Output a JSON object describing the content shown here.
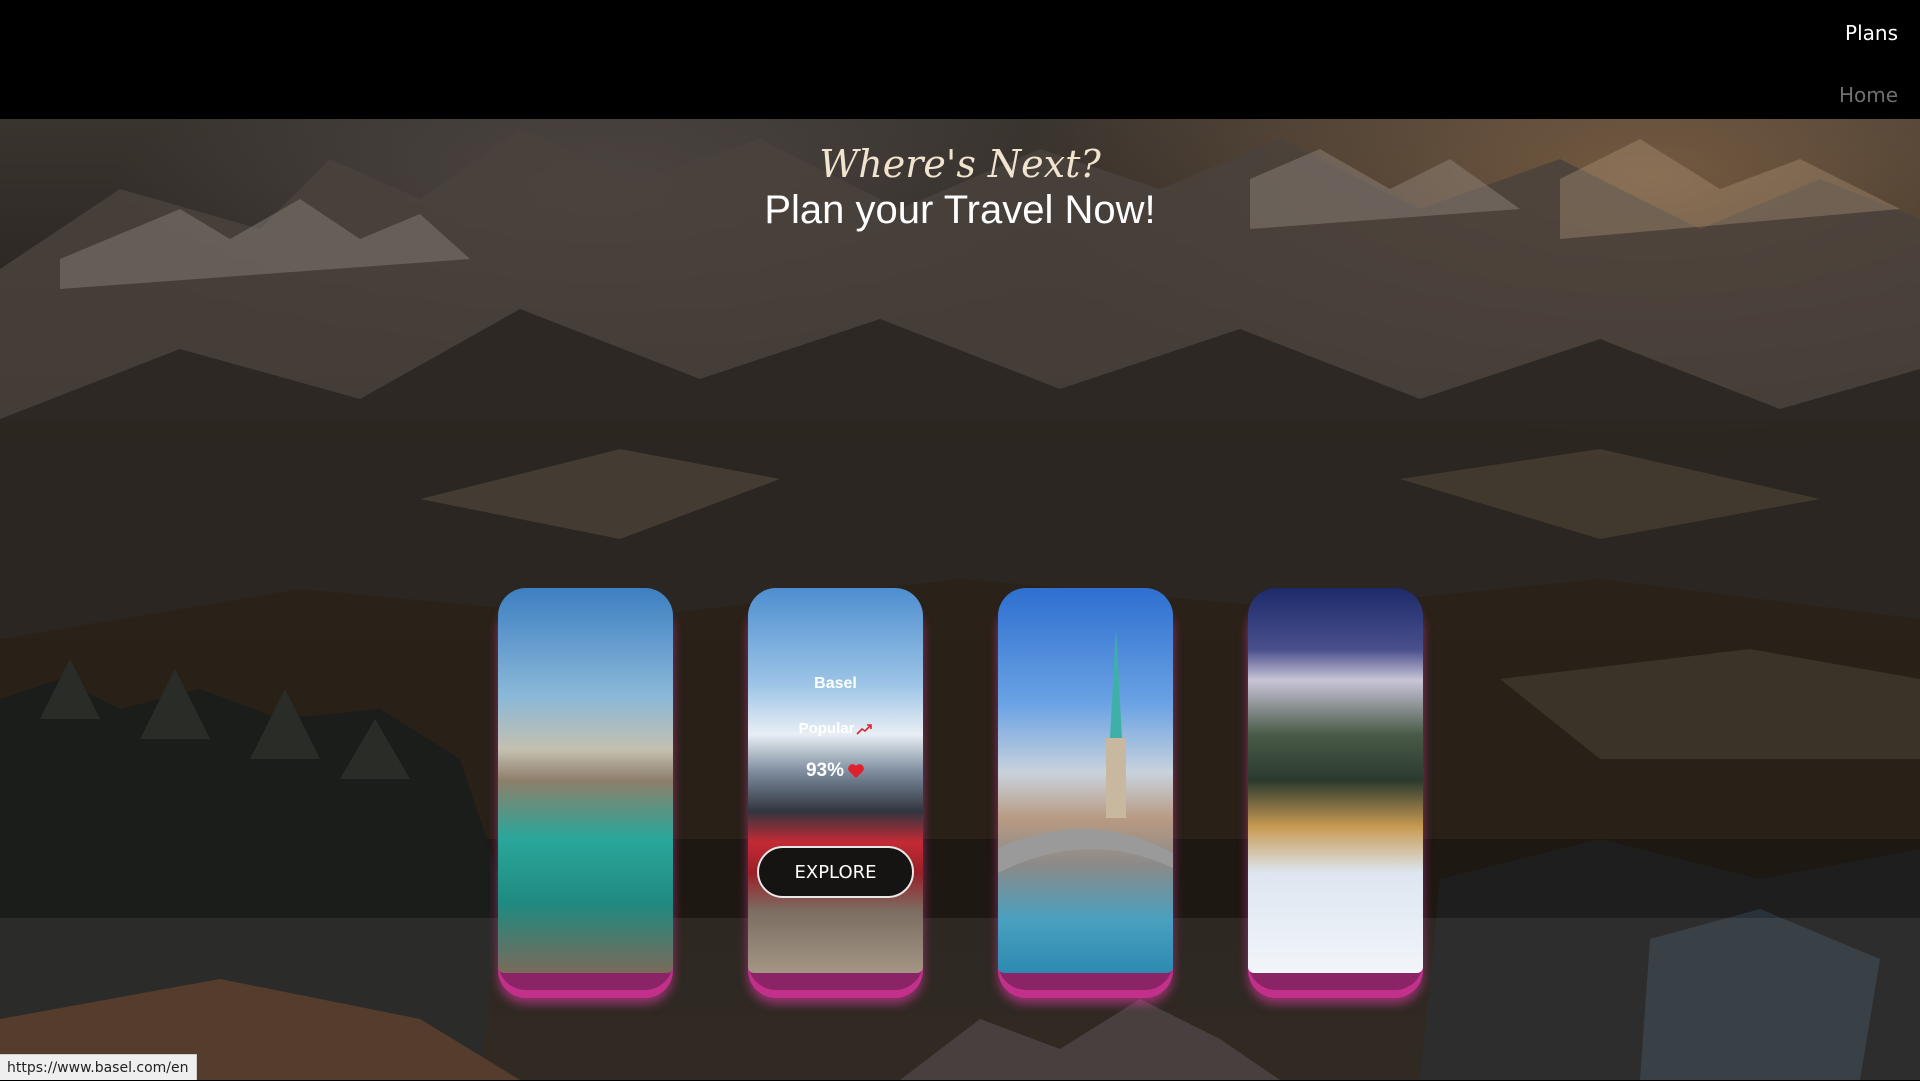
{
  "nav": {
    "plans": "Plans",
    "home": "Home"
  },
  "hero": {
    "subtitle": "Where's Next?",
    "title": "Plan your Travel Now!"
  },
  "cards": [
    {
      "image": "river-city-photo"
    },
    {
      "image": "mountain-train-photo",
      "name": "Basel",
      "popularity_label": "Popular",
      "popularity_icon": "trending-up-icon",
      "rating": "93%",
      "rating_icon": "heart-icon",
      "button": "EXPLORE"
    },
    {
      "image": "church-bridge-photo"
    },
    {
      "image": "snowy-village-night-photo"
    }
  ],
  "status_url": "https://www.basel.com/en",
  "colors": {
    "accent": "#c2308c",
    "heart": "#e0202a",
    "nav_active": "#ffffff",
    "nav_inactive": "#6f6f6f"
  }
}
